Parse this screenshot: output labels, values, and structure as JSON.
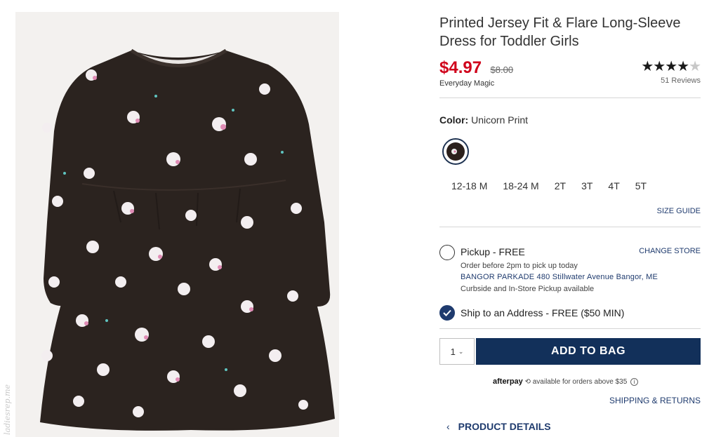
{
  "product": {
    "title": "Printed Jersey Fit & Flare Long-Sleeve Dress for Toddler Girls",
    "price_now": "$4.97",
    "price_was": "$8.00",
    "price_note": "Everyday Magic",
    "rating_stars": 4.5,
    "reviews": "51 Reviews"
  },
  "color": {
    "label": "Color:",
    "value": "Unicorn Print",
    "swatch_color": "#2b201c"
  },
  "sizes": [
    "12-18 M",
    "18-24 M",
    "2T",
    "3T",
    "4T",
    "5T"
  ],
  "size_guide": "SIZE GUIDE",
  "fulfillment": {
    "pickup": {
      "title": "Pickup - FREE",
      "change_store": "CHANGE STORE",
      "line1": "Order before 2pm to pick up today",
      "store": "BANGOR PARKADE 480 Stillwater Avenue  Bangor, ME",
      "line3": "Curbside and In-Store Pickup available"
    },
    "ship": {
      "title": "Ship to an Address - FREE ($50 MIN)",
      "selected": true
    }
  },
  "cart": {
    "quantity": "1",
    "add_label": "ADD TO BAG"
  },
  "afterpay": {
    "brand": "afterpay",
    "text": "available for orders above $35"
  },
  "shipping_link": "SHIPPING & RETURNS",
  "details_link": "PRODUCT DETAILS",
  "watermark": "ladiesrep.me",
  "colors": {
    "sale_red": "#d0021b",
    "navy": "#12305a",
    "link": "#1f3b6e"
  }
}
